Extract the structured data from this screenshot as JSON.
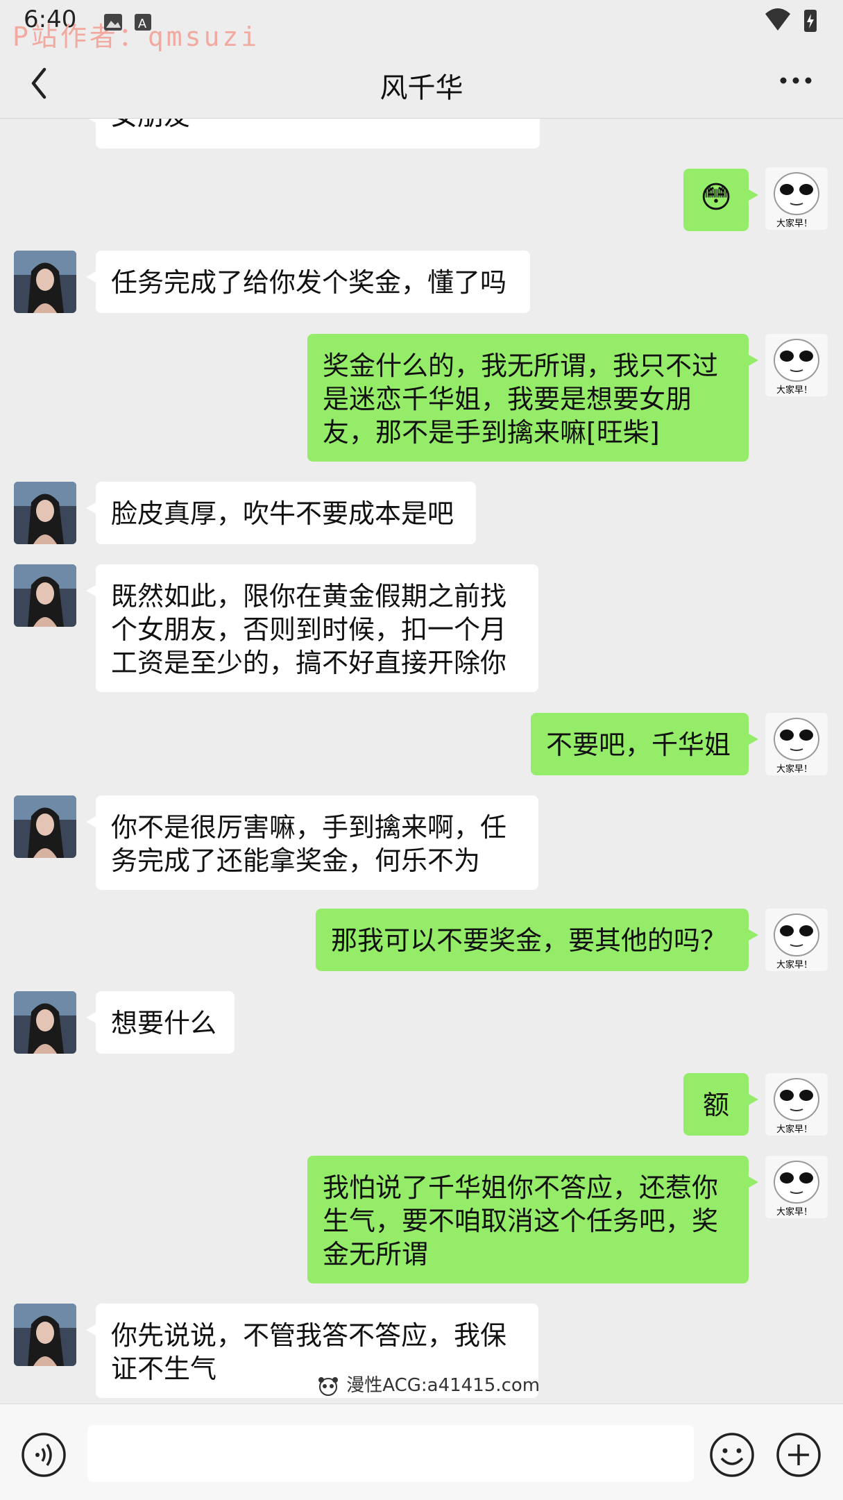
{
  "status_bar": {
    "time": "6:40",
    "watermark": "P站作者：qmsuzi"
  },
  "header": {
    "title": "风千华"
  },
  "messages": [
    {
      "side": "left",
      "text": "女朋友"
    },
    {
      "side": "right",
      "text": "😳"
    },
    {
      "side": "left",
      "text": "任务完成了给你发个奖金，懂了吗"
    },
    {
      "side": "right",
      "text": "奖金什么的，我无所谓，我只不过是迷恋千华姐，我要是想要女朋友，那不是手到擒来嘛[旺柴]"
    },
    {
      "side": "left",
      "text": "脸皮真厚，吹牛不要成本是吧"
    },
    {
      "side": "left",
      "text": "既然如此，限你在黄金假期之前找个女朋友，否则到时候，扣一个月工资是至少的，搞不好直接开除你"
    },
    {
      "side": "right",
      "text": "不要吧，千华姐"
    },
    {
      "side": "left",
      "text": "你不是很厉害嘛，手到擒来啊，任务完成了还能拿奖金，何乐不为"
    },
    {
      "side": "right",
      "text": "那我可以不要奖金，要其他的吗？"
    },
    {
      "side": "left",
      "text": "想要什么"
    },
    {
      "side": "right",
      "text": "额"
    },
    {
      "side": "right",
      "text": "我怕说了千华姐你不答应，还惹你生气，要不咱取消这个任务吧，奖金无所谓"
    },
    {
      "side": "left",
      "text": "你先说说，不管我答不答应，我保证不生气"
    }
  ],
  "my_avatar_caption": "大家早！",
  "site_watermark": "漫性ACG:a41415.com",
  "input": {
    "placeholder": ""
  }
}
